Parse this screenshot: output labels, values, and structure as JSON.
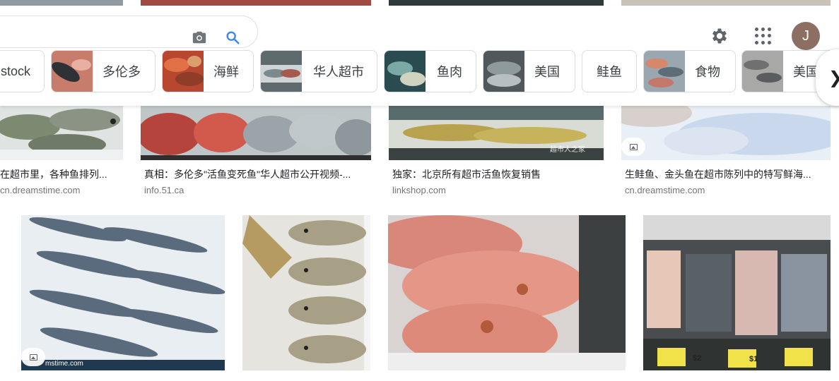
{
  "search": {
    "camera_icon": "camera-icon",
    "search_icon": "search-icon"
  },
  "header": {
    "settings_icon": "gear-icon",
    "apps_icon": "apps-grid-icon",
    "avatar_letter": "J",
    "avatar_color": "#8d6e63"
  },
  "chips": [
    {
      "label": "stock"
    },
    {
      "label": "多伦多"
    },
    {
      "label": "海鲜"
    },
    {
      "label": "华人超市"
    },
    {
      "label": "鱼肉"
    },
    {
      "label": "美国"
    },
    {
      "label": "鲑鱼"
    },
    {
      "label": "食物"
    },
    {
      "label": "美国"
    }
  ],
  "results_row1": [
    {
      "title": "在超市里，各种鱼排列...",
      "source": "cn.dreamstime.com"
    },
    {
      "title": "真相：多伦多\"活鱼变死鱼\"华人超市公开视频-...",
      "source": "info.51.ca"
    },
    {
      "title": "独家：北京所有超市活鱼恢复销售",
      "source": "linkshop.com"
    },
    {
      "title": "生鲑鱼、金头鱼在超市陈列中的特写鲜海...",
      "source": "cn.dreamstime.com"
    }
  ],
  "watermarks": {
    "r1_c3": "超市人之家",
    "r2_c1": "mstime.com",
    "r2_c4_tag1": "$2",
    "r2_c4_tag2": "$1"
  }
}
